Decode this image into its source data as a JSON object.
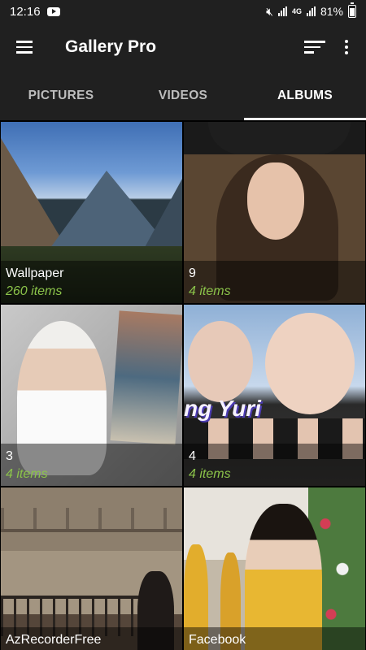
{
  "status_bar": {
    "time": "12:16",
    "network": "4G",
    "battery": "81%"
  },
  "app_bar": {
    "title": "Gallery Pro"
  },
  "tabs": [
    {
      "label": "PICTURES",
      "active": false
    },
    {
      "label": "VIDEOS",
      "active": false
    },
    {
      "label": "ALBUMS",
      "active": true
    }
  ],
  "albums": [
    {
      "name": "Wallpaper",
      "count": "260 items"
    },
    {
      "name": "9",
      "count": "4 items"
    },
    {
      "name": "3",
      "count": "4 items"
    },
    {
      "name": "4",
      "count": "4 items"
    },
    {
      "name": "AzRecorderFree",
      "count": ""
    },
    {
      "name": "Facebook",
      "count": ""
    }
  ],
  "thumb_text": {
    "album4_banner": "ng Yuri"
  },
  "colors": {
    "bar_bg": "#202020",
    "count_green": "#8bc34a",
    "tab_indicator": "#ffffff"
  }
}
